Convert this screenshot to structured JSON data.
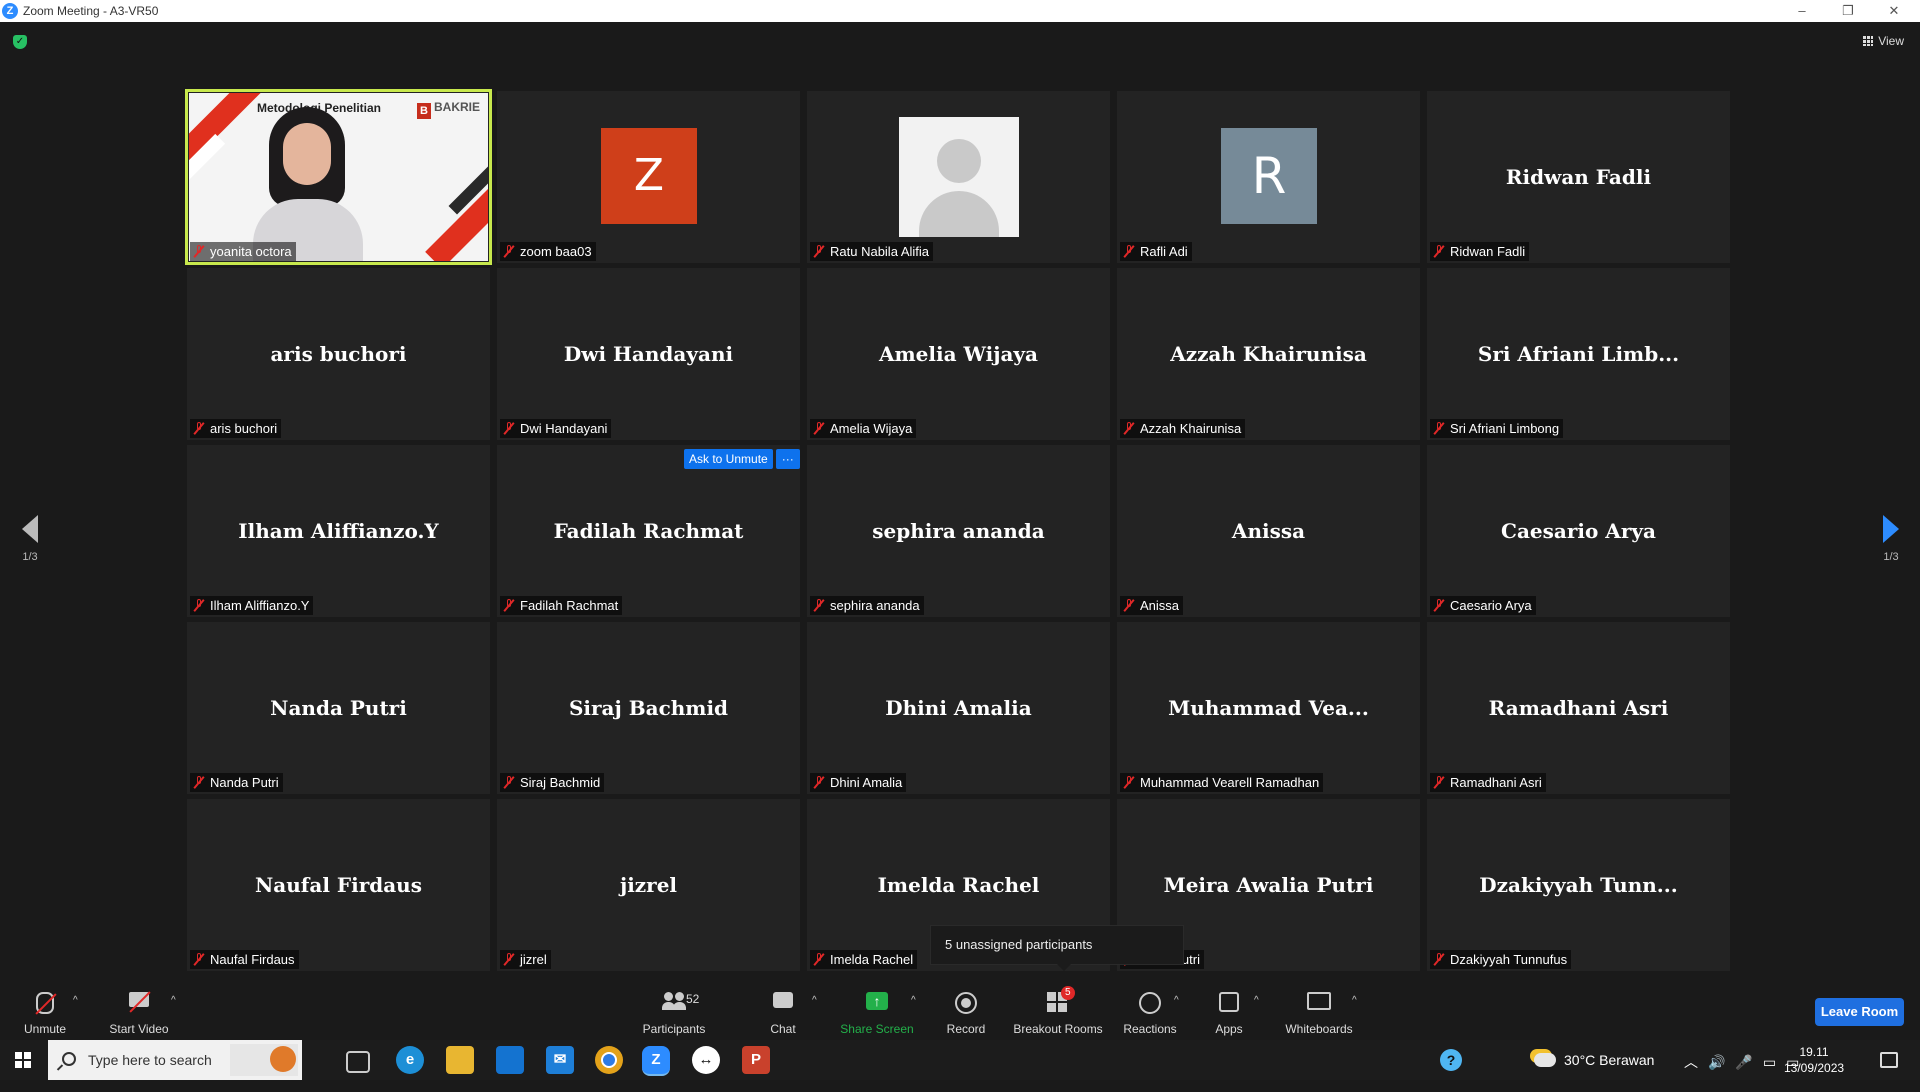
{
  "window": {
    "title": "Zoom Meeting - A3-VR50",
    "logo_letter": "Z",
    "minimize": "–",
    "restore": "❐",
    "close": "✕"
  },
  "view_label": "View",
  "tiles": [
    {
      "type": "speaker",
      "label": "yoanita octora",
      "slide_title": "Metodologi Penelitian",
      "slide_logo": "BAKRIE",
      "slide_logo_letter": "B"
    },
    {
      "type": "avatar-z",
      "letter": "Z",
      "label": "zoom baa03"
    },
    {
      "type": "photo",
      "label": "Ratu Nabila Alifia"
    },
    {
      "type": "avatar-r",
      "letter": "R",
      "label": "Rafli Adi"
    },
    {
      "type": "name",
      "big": "Ridwan Fadli",
      "label": "Ridwan Fadli"
    },
    {
      "type": "name",
      "big": "aris buchori",
      "label": "aris buchori"
    },
    {
      "type": "name",
      "big": "Dwi Handayani",
      "label": "Dwi Handayani"
    },
    {
      "type": "name",
      "big": "Amelia Wijaya",
      "label": "Amelia Wijaya"
    },
    {
      "type": "name",
      "big": "Azzah Khairunisa",
      "label": "Azzah Khairunisa"
    },
    {
      "type": "name",
      "big": "Sri  Afriani  Limb...",
      "label": "Sri Afriani Limbong"
    },
    {
      "type": "name",
      "big": "Ilham Aliffianzo.Y",
      "label": "Ilham Aliffianzo.Y"
    },
    {
      "type": "name",
      "big": "Fadilah Rachmat",
      "label": "Fadilah Rachmat"
    },
    {
      "type": "name",
      "big": "sephira ananda",
      "label": "sephira ananda"
    },
    {
      "type": "name",
      "big": "Anissa",
      "label": "Anissa"
    },
    {
      "type": "name",
      "big": "Caesario Arya",
      "label": "Caesario Arya"
    },
    {
      "type": "name",
      "big": "Nanda Putri",
      "label": "Nanda Putri"
    },
    {
      "type": "name",
      "big": "Siraj Bachmid",
      "label": "Siraj Bachmid"
    },
    {
      "type": "name",
      "big": "Dhini Amalia",
      "label": "Dhini Amalia"
    },
    {
      "type": "name",
      "big": "Muhammad  Vea...",
      "label": "Muhammad Vearell Ramadhan"
    },
    {
      "type": "name",
      "big": "Ramadhani Asri",
      "label": "Ramadhani Asri"
    },
    {
      "type": "name",
      "big": "Naufal Firdaus",
      "label": "Naufal Firdaus"
    },
    {
      "type": "name",
      "big": "jizrel",
      "label": "jizrel"
    },
    {
      "type": "name",
      "big": "Imelda Rachel",
      "label": "Imelda Rachel"
    },
    {
      "type": "name",
      "big": "Meira Awalia Putri",
      "label": "walia Putri"
    },
    {
      "type": "name",
      "big": "Dzakiyyah  Tunn...",
      "label": "Dzakiyyah Tunnufus"
    }
  ],
  "ask_to_unmute": "Ask to Unmute",
  "more_label": "···",
  "pager": {
    "left": "1/3",
    "right": "1/3"
  },
  "tooltip": "5 unassigned participants",
  "toolbar": {
    "unmute": "Unmute",
    "start_video": "Start Video",
    "participants": "Participants",
    "participants_count": "52",
    "chat": "Chat",
    "share_screen": "Share Screen",
    "record": "Record",
    "breakout_rooms": "Breakout Rooms",
    "breakout_badge": "5",
    "reactions": "Reactions",
    "apps": "Apps",
    "whiteboards": "Whiteboards",
    "leave": "Leave Room",
    "caret": "^"
  },
  "taskbar": {
    "search_placeholder": "Type here to search",
    "weather": "30°C  Berawan",
    "time": "19.11",
    "date": "13/09/2023"
  },
  "colors": {
    "accent": "#2d8cff",
    "muted_mic": "#e02828",
    "speaker_outline": "#c8e94d",
    "leave": "#1f6fe0",
    "share": "#23b04a"
  }
}
